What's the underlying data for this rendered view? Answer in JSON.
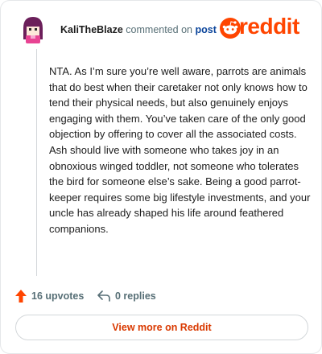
{
  "comment": {
    "username": "KaliTheBlaze",
    "action_text": "commented on",
    "post_link": "post",
    "body": "NTA. As I’m sure you’re well aware, parrots are animals that do best when their caretaker not only knows how to tend their physical needs, but also genuinely enjoys engaging with them. You’ve taken care of the only good objection by offering to cover all the associated costs. Ash should live with someone who takes joy in an obnoxious winged toddler, not someone who tolerates the bird for someone else’s sake. Being a good parrot-keeper requires some big lifestyle investments, and your uncle has already shaped his life around feathered companions."
  },
  "brand": {
    "logo_text": "reddit",
    "color": "#ff4500"
  },
  "actions": {
    "upvotes_label": "16 upvotes",
    "replies_label": "0 replies"
  },
  "footer": {
    "view_more_label": "View more on Reddit"
  },
  "icons": {
    "avatar": "avatar-icon",
    "upvote": "upvote-arrow-icon",
    "reply": "reply-arrow-icon",
    "logo": "reddit-snoo-icon"
  }
}
